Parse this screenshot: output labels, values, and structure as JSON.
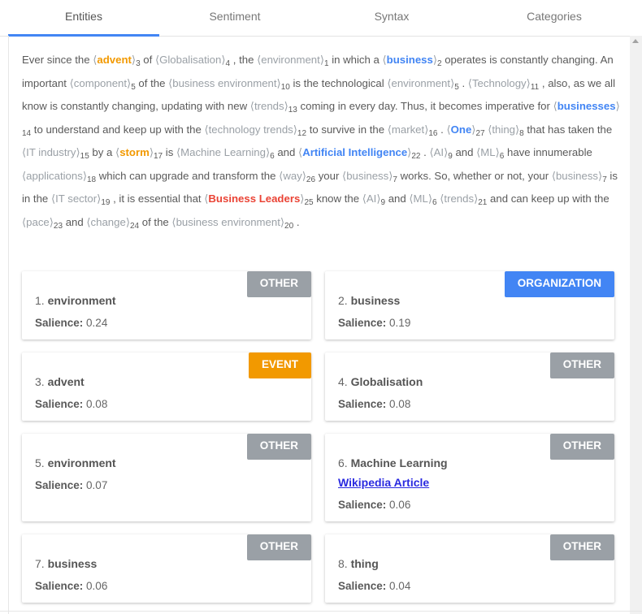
{
  "tabs": [
    {
      "label": "Entities",
      "active": true
    },
    {
      "label": "Sentiment",
      "active": false
    },
    {
      "label": "Syntax",
      "active": false
    },
    {
      "label": "Categories",
      "active": false
    }
  ],
  "colors": {
    "accent": "#4285f4",
    "organization": "#4285f4",
    "event": "#f29900",
    "person": "#ea4335",
    "other": "#9aa0a6"
  },
  "text_segments": [
    {
      "t": "Ever since the "
    },
    {
      "e": "advent",
      "n": "3",
      "k": "event"
    },
    {
      "t": " of "
    },
    {
      "e": "Globalisation",
      "n": "4",
      "k": "other"
    },
    {
      "t": " , the "
    },
    {
      "e": "environment",
      "n": "1",
      "k": "other"
    },
    {
      "t": " in which a "
    },
    {
      "e": "business",
      "n": "2",
      "k": "org"
    },
    {
      "t": " operates is constantly changing. An important "
    },
    {
      "e": "component",
      "n": "5",
      "k": "other"
    },
    {
      "t": " of the "
    },
    {
      "e": "business environment",
      "n": "10",
      "k": "other"
    },
    {
      "t": " is the technological "
    },
    {
      "e": "environment",
      "n": "5",
      "k": "other"
    },
    {
      "t": " . "
    },
    {
      "e": "Technology",
      "n": "11",
      "k": "other"
    },
    {
      "t": " , also, as we all know is constantly changing, updating with new "
    },
    {
      "e": "trends",
      "n": "13",
      "k": "other"
    },
    {
      "t": " coming in every day. Thus, it becomes imperative for "
    },
    {
      "e": "businesses",
      "n": "14",
      "k": "org"
    },
    {
      "t": " to understand and keep up with the "
    },
    {
      "e": "technology trends",
      "n": "12",
      "k": "other"
    },
    {
      "t": " to survive in the "
    },
    {
      "e": "market",
      "n": "16",
      "k": "other"
    },
    {
      "t": " . "
    },
    {
      "e": "One",
      "n": "27",
      "k": "org"
    },
    {
      "t": " "
    },
    {
      "e": "thing",
      "n": "8",
      "k": "other"
    },
    {
      "t": " that has taken the "
    },
    {
      "e": "IT industry",
      "n": "15",
      "k": "other"
    },
    {
      "t": " by a "
    },
    {
      "e": "storm",
      "n": "17",
      "k": "event"
    },
    {
      "t": " is "
    },
    {
      "e": "Machine Learning",
      "n": "6",
      "k": "other"
    },
    {
      "t": " and "
    },
    {
      "e": "Artificial Intelligence",
      "n": "22",
      "k": "org"
    },
    {
      "t": " . "
    },
    {
      "e": "AI",
      "n": "9",
      "k": "other"
    },
    {
      "t": " and "
    },
    {
      "e": "ML",
      "n": "6",
      "k": "other"
    },
    {
      "t": " have innumerable "
    },
    {
      "e": "applications",
      "n": "18",
      "k": "other"
    },
    {
      "t": " which can upgrade and transform the "
    },
    {
      "e": "way",
      "n": "26",
      "k": "other"
    },
    {
      "t": " your "
    },
    {
      "e": "business",
      "n": "7",
      "k": "other"
    },
    {
      "t": " works. So, whether or not, your "
    },
    {
      "e": "business",
      "n": "7",
      "k": "other"
    },
    {
      "t": " is in the "
    },
    {
      "e": "IT sector",
      "n": "19",
      "k": "other"
    },
    {
      "t": " , it is essential that "
    },
    {
      "e": "Business Leaders",
      "n": "25",
      "k": "person"
    },
    {
      "t": " know the "
    },
    {
      "e": "AI",
      "n": "9",
      "k": "other"
    },
    {
      "t": " and "
    },
    {
      "e": "ML",
      "n": "6",
      "k": "other"
    },
    {
      "t": " "
    },
    {
      "e": "trends",
      "n": "21",
      "k": "other"
    },
    {
      "t": " and can keep up with the "
    },
    {
      "e": "pace",
      "n": "23",
      "k": "other"
    },
    {
      "t": " and "
    },
    {
      "e": "change",
      "n": "24",
      "k": "other"
    },
    {
      "t": " of the "
    },
    {
      "e": "business environment",
      "n": "20",
      "k": "other"
    },
    {
      "t": " ."
    }
  ],
  "salience_label": "Salience:",
  "entities": [
    {
      "index": "1.",
      "name": "environment",
      "type": "OTHER",
      "salience": "0.24"
    },
    {
      "index": "2.",
      "name": "business",
      "type": "ORGANIZATION",
      "salience": "0.19"
    },
    {
      "index": "3.",
      "name": "advent",
      "type": "EVENT",
      "salience": "0.08"
    },
    {
      "index": "4.",
      "name": "Globalisation",
      "type": "OTHER",
      "salience": "0.08"
    },
    {
      "index": "5.",
      "name": "environment",
      "type": "OTHER",
      "salience": "0.07"
    },
    {
      "index": "6.",
      "name": "Machine Learning",
      "type": "OTHER",
      "salience": "0.06",
      "link": "Wikipedia Article"
    },
    {
      "index": "7.",
      "name": "business",
      "type": "OTHER",
      "salience": "0.06"
    },
    {
      "index": "8.",
      "name": "thing",
      "type": "OTHER",
      "salience": "0.04"
    }
  ]
}
